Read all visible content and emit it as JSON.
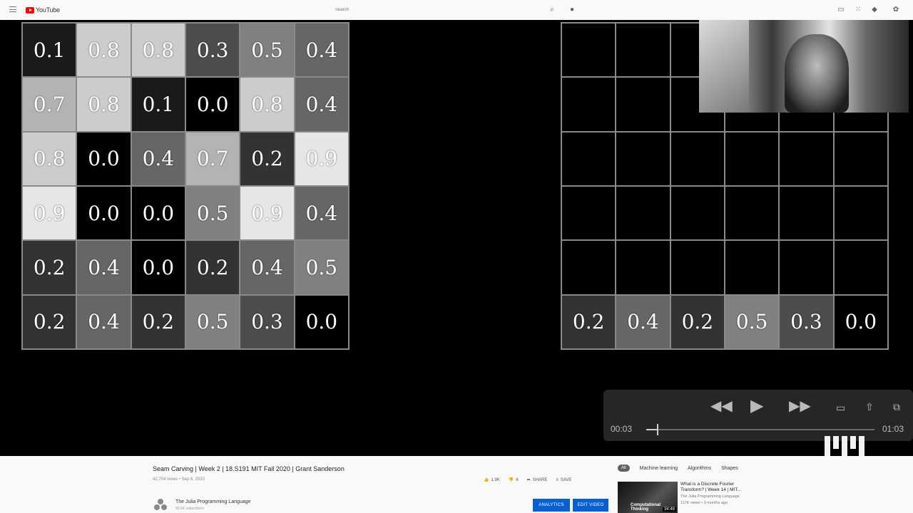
{
  "topbar": {
    "logo_text": "YouTube",
    "search_placeholder": "Search",
    "icons": [
      "menu-icon",
      "search-icon",
      "mic-icon",
      "create-icon",
      "apps-icon",
      "notifications-icon",
      "account-icon"
    ]
  },
  "player": {
    "left_grid": [
      [
        "0.1",
        "0.8",
        "0.8",
        "0.3",
        "0.5",
        "0.4"
      ],
      [
        "0.7",
        "0.8",
        "0.1",
        "0.0",
        "0.8",
        "0.4"
      ],
      [
        "0.8",
        "0.0",
        "0.4",
        "0.7",
        "0.2",
        "0.9"
      ],
      [
        "0.9",
        "0.0",
        "0.0",
        "0.5",
        "0.9",
        "0.4"
      ],
      [
        "0.2",
        "0.4",
        "0.0",
        "0.2",
        "0.4",
        "0.5"
      ],
      [
        "0.2",
        "0.4",
        "0.2",
        "0.5",
        "0.3",
        "0.0"
      ]
    ],
    "right_grid": [
      [
        "",
        "",
        "",
        "",
        "",
        ""
      ],
      [
        "",
        "",
        "",
        "",
        "",
        ""
      ],
      [
        "",
        "",
        "",
        "",
        "",
        ""
      ],
      [
        "",
        "",
        "",
        "",
        "",
        ""
      ],
      [
        "",
        "",
        "",
        "",
        "",
        ""
      ],
      [
        "0.2",
        "0.4",
        "0.2",
        "0.5",
        "0.3",
        "0.0"
      ]
    ],
    "controls": {
      "current_time": "00:03",
      "duration": "01:03",
      "progress": 0.05
    }
  },
  "video": {
    "title": "Seam Carving | Week 2 | 18.S191 MIT Fall 2020 | Grant Sanderson",
    "meta": "42,704 views • Sep 8, 2020",
    "likes": "1.9K",
    "dislikes": "6",
    "share_label": "SHARE",
    "save_label": "SAVE",
    "channel_name": "The Julia Programming Language",
    "channel_subs": "55.5K subscribers",
    "analytics_label": "ANALYTICS",
    "edit_label": "EDIT VIDEO"
  },
  "sidebar": {
    "chips": [
      "All",
      "Machine learning",
      "Algorithms",
      "Shapes"
    ],
    "recommended": {
      "title": "What is a Discrete Fourier Transform? | Week 14 | MIT...",
      "channel": "The Julia Programming Language",
      "views": "117K views • 3 months ago",
      "duration": "34:48",
      "thumb_text": "Computational Thinking"
    }
  },
  "colors": {
    "accent": "#065fd4",
    "brand_red": "#ff0000"
  }
}
